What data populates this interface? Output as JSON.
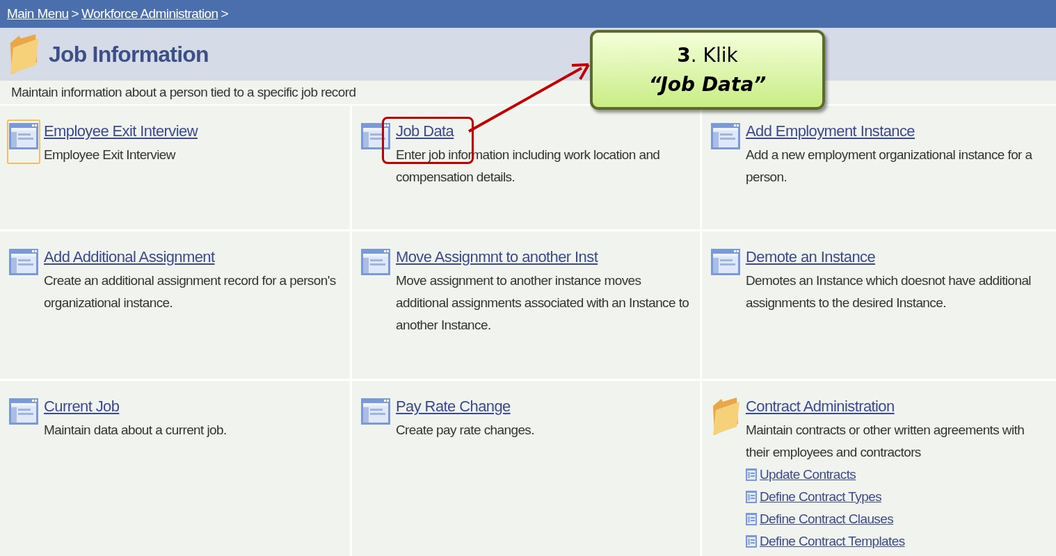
{
  "breadcrumb": [
    "Main Menu",
    "Workforce Administration"
  ],
  "breadcrumb_separator": ">",
  "page": {
    "title": "Job Information",
    "description": "Maintain information about a person tied to a specific job record"
  },
  "items": [
    {
      "kind": "page",
      "title": "Employee Exit Interview",
      "description": "Employee Exit Interview",
      "focused": true,
      "highlighted": false
    },
    {
      "kind": "page",
      "title": "Job Data",
      "description": "Enter job information including work location and compensation details.",
      "focused": false,
      "highlighted": true
    },
    {
      "kind": "page",
      "title": "Add Employment Instance",
      "description": "Add a new employment organizational instance for a person.",
      "focused": false,
      "highlighted": false
    },
    {
      "kind": "page",
      "title": "Add Additional Assignment",
      "description": "Create an additional assignment record for a person's organizational instance.",
      "focused": false,
      "highlighted": false
    },
    {
      "kind": "page",
      "title": "Move Assignmnt to another Inst",
      "description": "Move assignment to another instance moves additional assignments associated with an Instance to another Instance.",
      "focused": false,
      "highlighted": false
    },
    {
      "kind": "page",
      "title": "Demote an Instance",
      "description": "Demotes an Instance which doesnot have additional assignments to the desired Instance.",
      "focused": false,
      "highlighted": false
    },
    {
      "kind": "page",
      "title": "Current Job",
      "description": "Maintain data about a current job.",
      "focused": false,
      "highlighted": false
    },
    {
      "kind": "page",
      "title": "Pay Rate Change",
      "description": "Create pay rate changes.",
      "focused": false,
      "highlighted": false
    },
    {
      "kind": "folder",
      "title": "Contract Administration",
      "description": "Maintain contracts or other written agreements with their employees and contractors",
      "focused": false,
      "highlighted": false,
      "links": [
        "Update Contracts",
        "Define Contract Types",
        "Define Contract Clauses",
        "Define Contract Templates"
      ]
    }
  ],
  "callout": {
    "step": "**3**. Klik",
    "target": "“Job Data”"
  }
}
